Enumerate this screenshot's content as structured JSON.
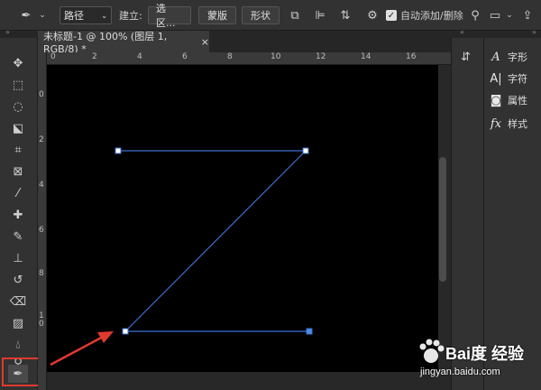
{
  "options_bar": {
    "pen_tool_icon": "pen-icon",
    "mode_select": "路径",
    "make_label": "建立:",
    "selection_button": "选区...",
    "mask_button": "蒙版",
    "shape_button": "形状",
    "auto_add_delete_checked": true,
    "auto_add_delete_label": "自动添加/删除"
  },
  "document_tab": {
    "title": "未标题-1 @ 100% (图层 1, RGB/8) *",
    "close_label": "×"
  },
  "ruler_h": [
    "0",
    "2",
    "4",
    "6",
    "8",
    "10",
    "12",
    "14",
    "16"
  ],
  "ruler_v": [
    "0",
    "2",
    "4",
    "6",
    "8",
    "1\n0"
  ],
  "panels": [
    {
      "label": "字形",
      "icon": "glyph-icon"
    },
    {
      "label": "字符",
      "icon": "character-icon"
    },
    {
      "label": "属性",
      "icon": "properties-icon"
    },
    {
      "label": "样式",
      "icon": "fx-styles-icon"
    }
  ],
  "path": {
    "anchor_color": "#4a90e2",
    "line_color": "#3d6fd1"
  },
  "annotation": {
    "arrow_color": "#e03a2e"
  },
  "watermark": {
    "brand": "Bai度 经验",
    "url": "jingyan.baidu.com"
  }
}
